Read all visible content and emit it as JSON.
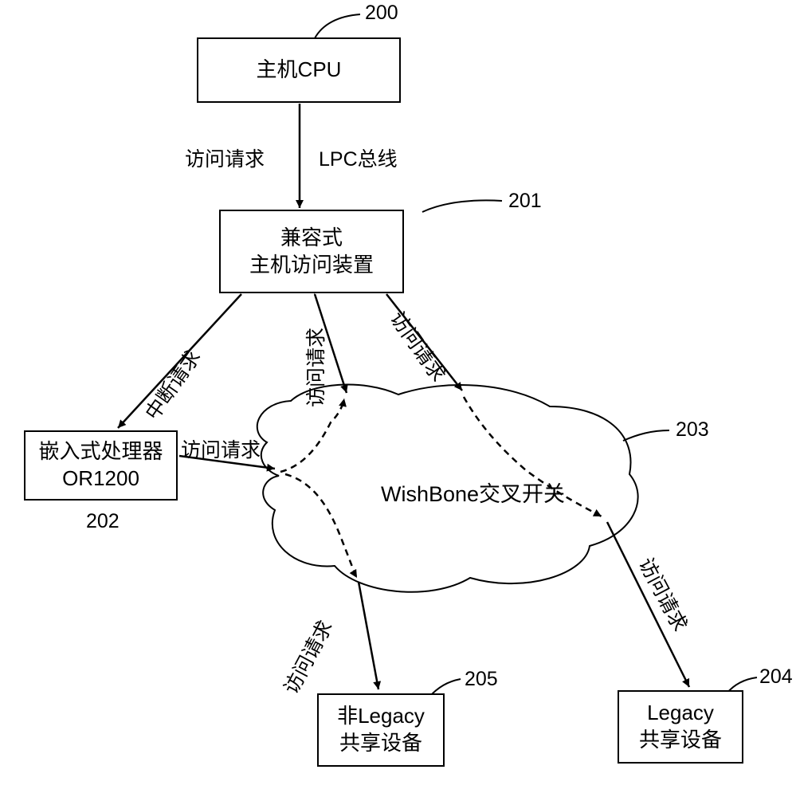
{
  "nodes": {
    "cpu": {
      "ref": "200",
      "label": "主机CPU"
    },
    "host_access": {
      "ref": "201",
      "line1": "兼容式",
      "line2": "主机访问装置"
    },
    "embedded": {
      "ref": "202",
      "line1": "嵌入式处理器",
      "line2": "OR1200"
    },
    "crossbar": {
      "ref": "203",
      "label": "WishBone交叉开关"
    },
    "legacy": {
      "ref": "204",
      "line1": "Legacy",
      "line2": "共享设备"
    },
    "non_legacy": {
      "ref": "205",
      "line1": "非Legacy",
      "line2": "共享设备"
    }
  },
  "edges": {
    "cpu_to_host_left": "访问请求",
    "cpu_to_host_right": "LPC总线",
    "host_to_embedded": "中断请求",
    "host_to_crossbar_left": "访问请求",
    "host_to_crossbar_right": "访问请求",
    "embedded_to_crossbar": "访问请求",
    "crossbar_to_nonlegacy": "访问请求",
    "crossbar_to_legacy": "访问请求"
  }
}
